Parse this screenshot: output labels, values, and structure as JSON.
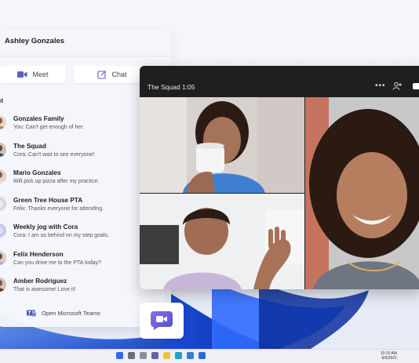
{
  "user": {
    "name": "Ashley Gonzales"
  },
  "actions": {
    "meet_label": "Meet",
    "chat_label": "Chat"
  },
  "recent_label": "nt",
  "chats": [
    {
      "name": "Gonzales Family",
      "preview": "You: Can't get enough of her.",
      "avatar_color": "#8a5a44"
    },
    {
      "name": "The Squad",
      "preview": "Cora: Can't wait to see everyone!",
      "avatar_color": "#5f4535"
    },
    {
      "name": "Mario Gonzales",
      "preview": "Will pick up pizza after my practice.",
      "avatar_color": "#7a5a49"
    },
    {
      "name": "Green Tree House PTA",
      "preview": "Felix: Thanks everyone for attending.",
      "avatar_color": "#d6d8de"
    },
    {
      "name": "Weekly jog with Cora",
      "preview": "Cora: I am so behind on my step goals.",
      "avatar_color": "#c8c6ee"
    },
    {
      "name": "Felix Henderson",
      "preview": "Can you drive me to the PTA today?",
      "avatar_color": "#6e4a3a"
    },
    {
      "name": "Amber Rodriguez",
      "preview": "That is awesome! Love it!",
      "avatar_color": "#7b5440"
    }
  ],
  "open_teams_label": "Open Microsoft Teams",
  "call": {
    "title": "The Squad 1:05",
    "more_label": "•••"
  },
  "colors": {
    "accent": "#5b5fc7",
    "call_bg": "#1f1f1f",
    "bloom": "#1f5fd6"
  },
  "taskbar": {
    "time": "10:10 AM",
    "date": "6/6/2021"
  }
}
